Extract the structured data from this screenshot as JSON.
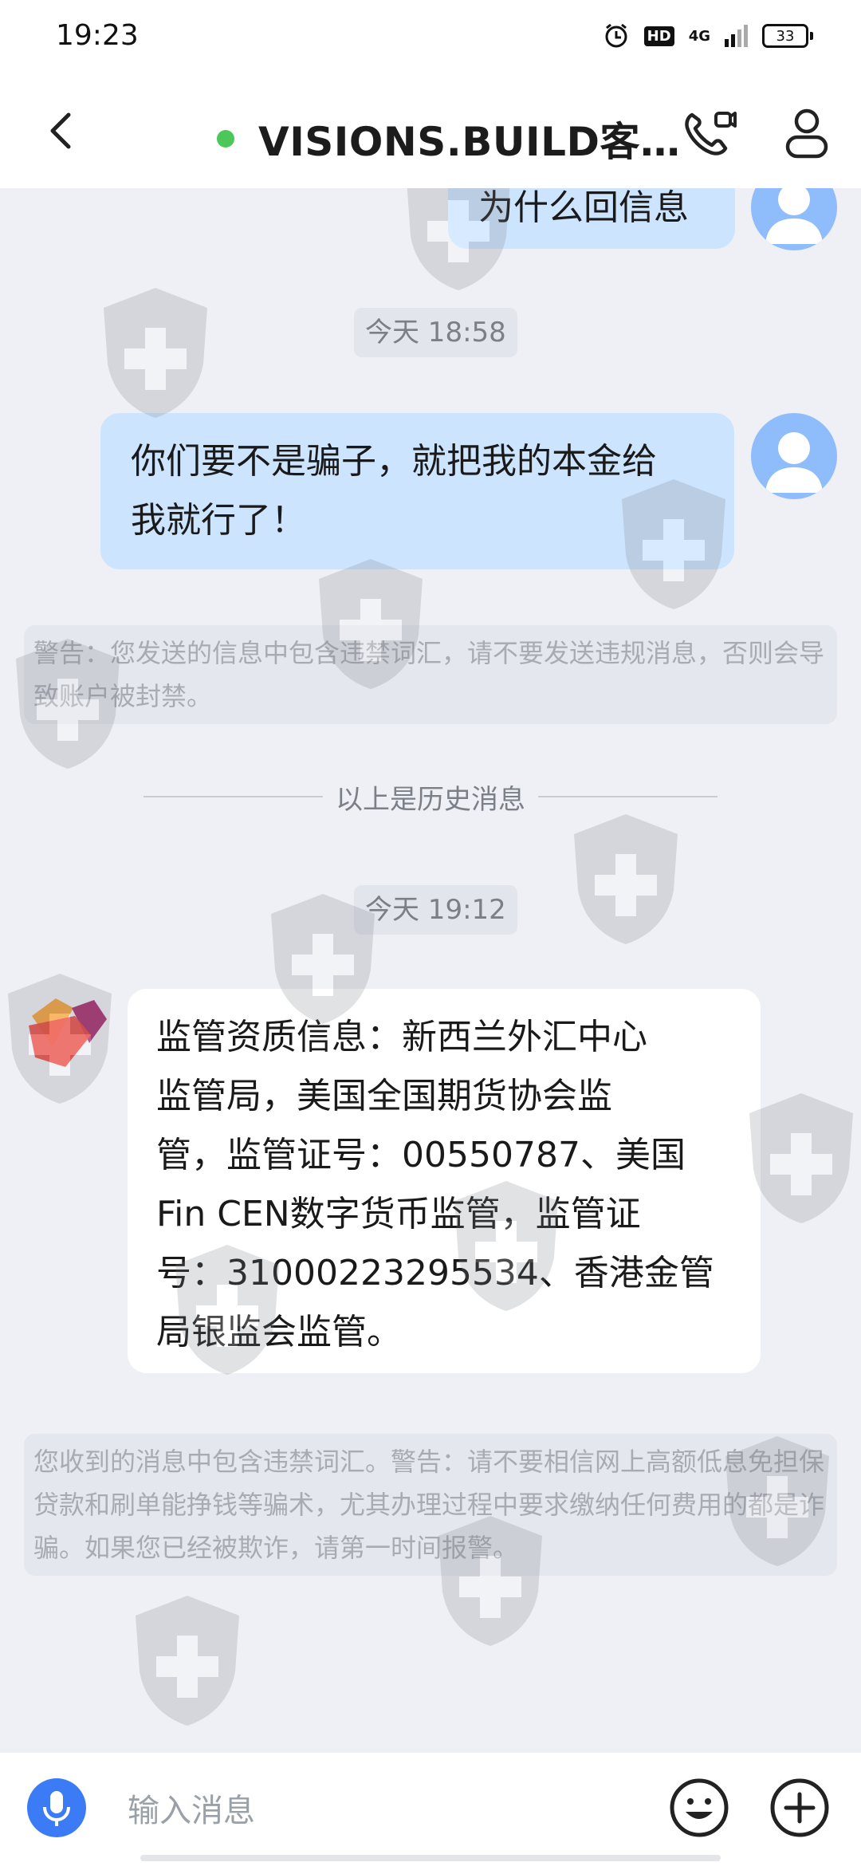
{
  "status_bar": {
    "time": "19:23",
    "network": "4G",
    "hd": "HD",
    "battery": "33"
  },
  "header": {
    "title": "VISIONS.BUILD客…",
    "online": true
  },
  "messages": {
    "partial_out": "为什么回信息",
    "time1": "今天 18:58",
    "out_line1": "你们要不是骗子，就把我的本金给",
    "out_line2": "我就行了！",
    "warning_sent": "警告：您发送的信息中包含违禁词汇，请不要发送违规消息，否则会导致账户被封禁。",
    "history_divider": "以上是历史消息",
    "time2": "今天 19:12",
    "in_lines": [
      "监管资质信息：新西兰外汇中心",
      "监管局，美国全国期货协会监",
      "管，监管证号：00550787、美国",
      "Fin CEN数字货币监管，监管证",
      "号：31000223295534、香港金管",
      "局银监会监管。"
    ],
    "warning_received": "您收到的消息中包含违禁词汇。警告：请不要相信网上高额低息免担保贷款和刷单能挣钱等骗术，尤其办理过程中要求缴纳任何费用的都是诈骗。如果您已经被欺诈，请第一时间报警。"
  },
  "input": {
    "placeholder": "输入消息"
  },
  "colors": {
    "accent": "#3b7cf6",
    "outgoing_bubble": "#cde4ff",
    "online": "#4cc85a",
    "background": "#eef0f5"
  },
  "icons": {
    "back": "chevron-left-icon",
    "call": "phone-call-icon",
    "profile": "person-icon",
    "mic": "microphone-icon",
    "emoji": "smiley-icon",
    "plus": "plus-circle-icon"
  }
}
